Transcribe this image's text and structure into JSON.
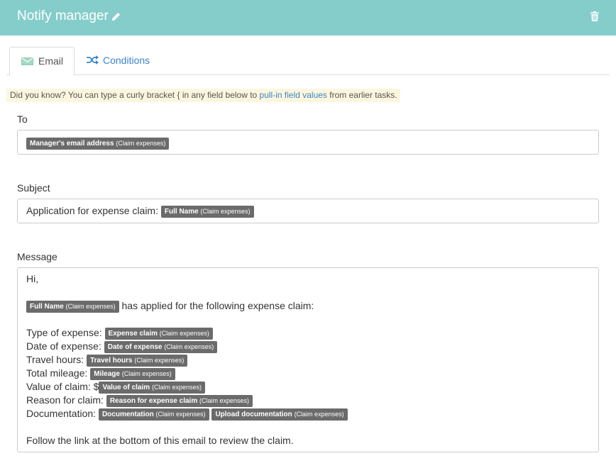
{
  "header": {
    "title": "Notify manager"
  },
  "tabs": [
    {
      "label": "Email"
    },
    {
      "label": "Conditions"
    }
  ],
  "tip": {
    "prefix": "Did you know? You can type a curly bracket { in any field below to ",
    "link": "pull-in field values",
    "suffix": " from earlier tasks."
  },
  "to": {
    "label": "To",
    "chip": {
      "name": "Manager's email address",
      "source": "(Claim expenses)"
    }
  },
  "subject": {
    "label": "Subject",
    "text": "Application for expense claim:",
    "chip": {
      "name": "Full Name",
      "source": "(Claim expenses)"
    }
  },
  "message": {
    "label": "Message",
    "greeting": "Hi,",
    "intro_chip": {
      "name": "Full Name",
      "source": "(Claim expenses)"
    },
    "intro_text": "has applied for the following expense claim:",
    "rows": [
      {
        "label": "Type of expense:",
        "chip": {
          "name": "Expense claim",
          "source": "(Claim expenses)"
        }
      },
      {
        "label": "Date of expense:",
        "chip": {
          "name": "Date of expense",
          "source": "(Claim expenses)"
        }
      },
      {
        "label": "Travel hours:",
        "chip": {
          "name": "Travel hours",
          "source": "(Claim expenses)"
        }
      },
      {
        "label": "Total mileage:",
        "chip": {
          "name": "Mileage",
          "source": "(Claim expenses)"
        }
      },
      {
        "label": "Value of claim: $",
        "chip": {
          "name": "Value of claim",
          "source": "(Claim expenses)"
        }
      },
      {
        "label": "Reason for claim:",
        "chip": {
          "name": "Reason for expense claim",
          "source": "(Claim expenses)"
        }
      },
      {
        "label": "Documentation:",
        "chip": {
          "name": "Documentation",
          "source": "(Claim expenses)"
        },
        "chip2": {
          "name": "Upload documentation",
          "source": "(Claim expenses)"
        }
      }
    ],
    "footer": "Follow the link at the bottom of this email to review the claim."
  },
  "colors": {
    "header": "#84cdca",
    "chip": "#6b6b6b",
    "link": "#3a85c6",
    "tip_bg": "#fcf6df"
  },
  "icons": {
    "edit": "pencil-icon",
    "delete": "trash-icon",
    "email_tab": "envelope-icon",
    "conditions_tab": "shuffle-icon"
  }
}
